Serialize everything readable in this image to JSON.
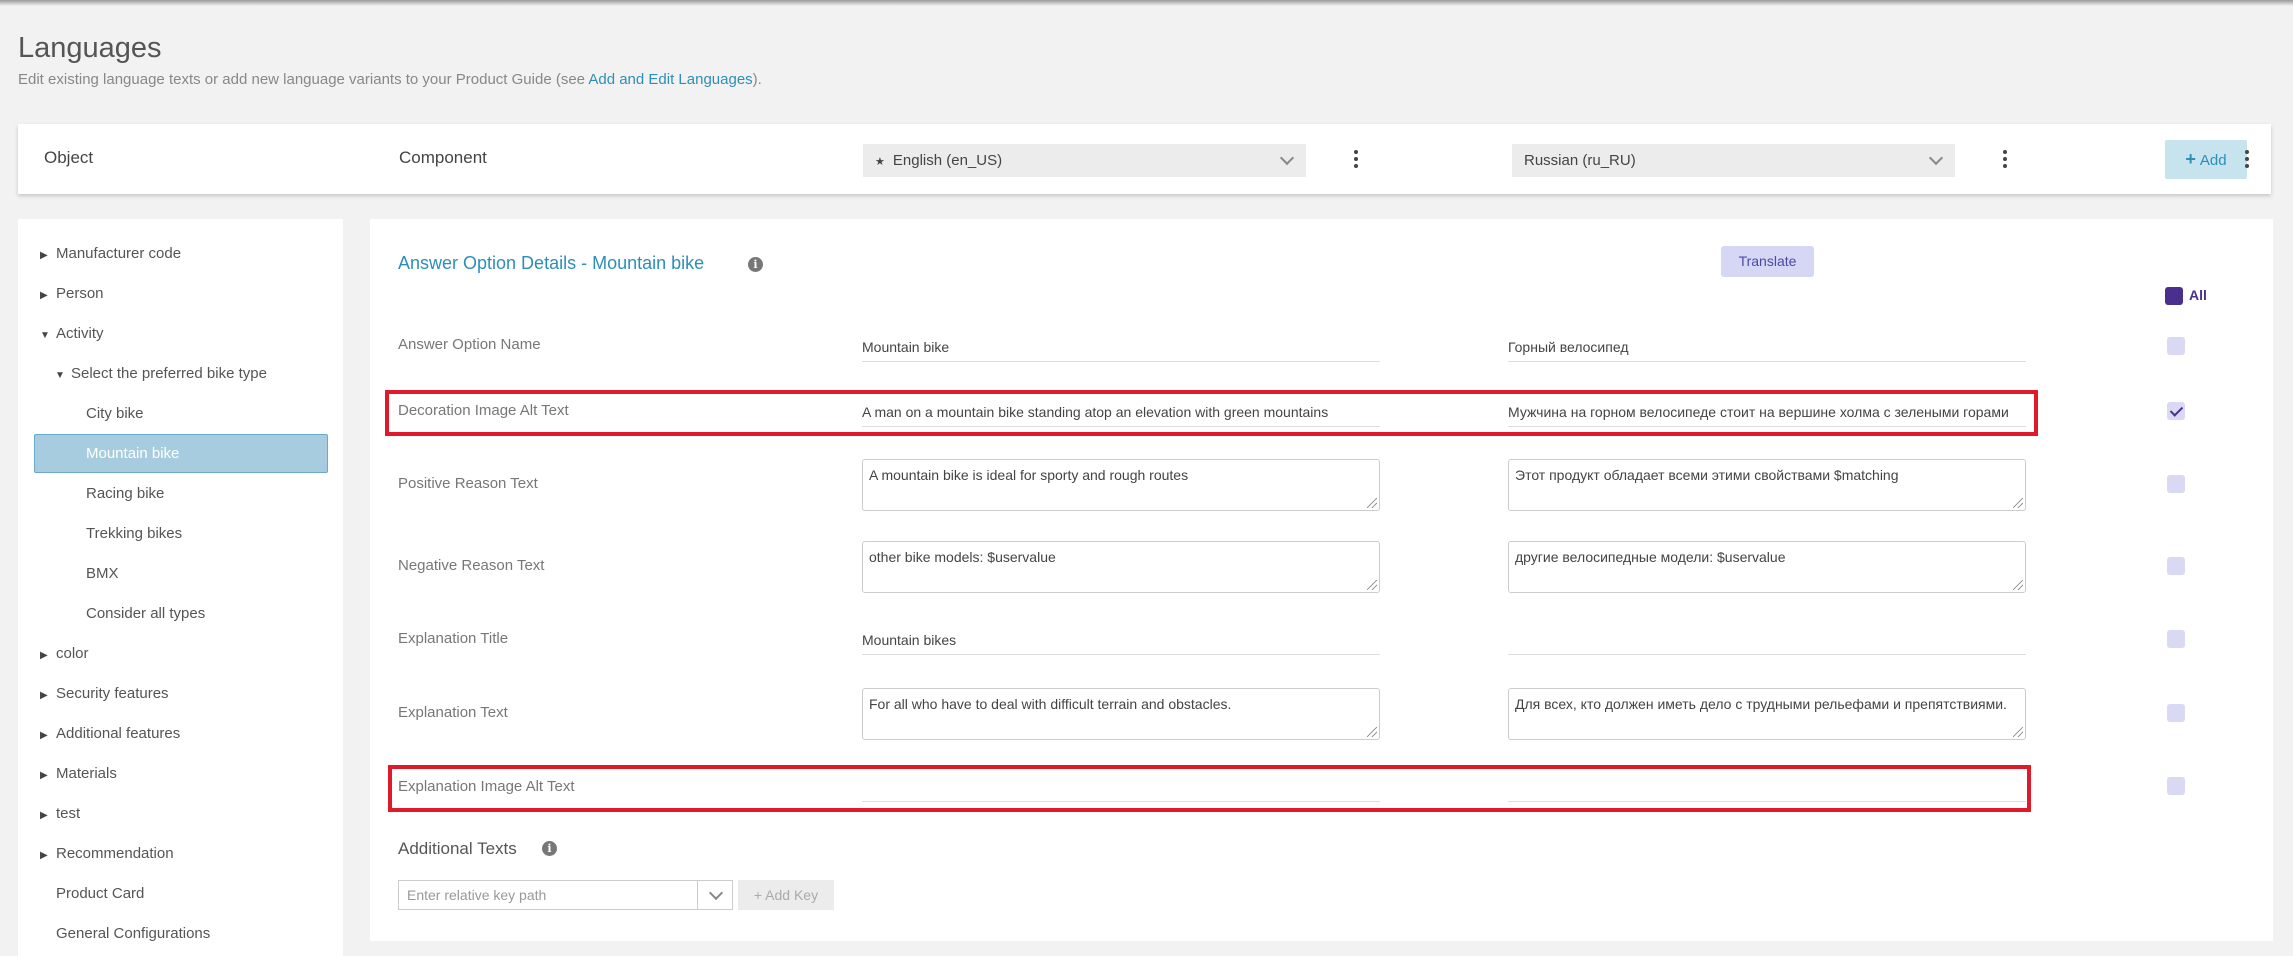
{
  "page": {
    "title": "Languages",
    "subtitle_prefix": "Edit existing language texts or add new language variants to your Product Guide (see ",
    "subtitle_link": "Add and Edit Languages",
    "subtitle_suffix": ")."
  },
  "header": {
    "object_label": "Object",
    "component_label": "Component",
    "primary_language": "English (en_US)",
    "secondary_language": "Russian (ru_RU)",
    "add_label": "Add"
  },
  "tree": [
    {
      "label": "Manufacturer code",
      "arrow": "▶"
    },
    {
      "label": "Person",
      "arrow": "▶"
    },
    {
      "label": "Activity",
      "arrow": "▼"
    },
    {
      "label": "Select the preferred bike type",
      "arrow": "▼"
    },
    {
      "label": "City bike",
      "arrow": ""
    },
    {
      "label": "Mountain bike",
      "arrow": "",
      "selected": true
    },
    {
      "label": "Racing bike",
      "arrow": ""
    },
    {
      "label": "Trekking bikes",
      "arrow": ""
    },
    {
      "label": "BMX",
      "arrow": ""
    },
    {
      "label": "Consider all types",
      "arrow": ""
    },
    {
      "label": "color",
      "arrow": "▶"
    },
    {
      "label": "Security features",
      "arrow": "▶"
    },
    {
      "label": "Additional features",
      "arrow": "▶"
    },
    {
      "label": "Materials",
      "arrow": "▶"
    },
    {
      "label": "test",
      "arrow": "▶"
    },
    {
      "label": "Recommendation",
      "arrow": "▶"
    },
    {
      "label": "Product Card",
      "arrow": ""
    },
    {
      "label": "General Configurations",
      "arrow": ""
    }
  ],
  "details": {
    "title": "Answer Option Details - Mountain bike",
    "translate_label": "Translate",
    "all_label": "All",
    "rows": [
      {
        "label": "Answer Option Name",
        "en": "Mountain bike",
        "ru": "Горный велосипед",
        "checked": false
      },
      {
        "label": "Decoration Image Alt Text",
        "en": "A man on a mountain bike standing atop an elevation with green mountains",
        "ru": "Мужчина на горном велосипеде стоит на вершине холма с зелеными горами",
        "checked": true
      },
      {
        "label": "Positive Reason Text",
        "en": "A mountain bike is ideal for sporty and rough routes",
        "ru": "Этот продукт обладает всеми этими свойствами $matching",
        "checked": false
      },
      {
        "label": "Negative Reason Text",
        "en": "other bike models: $uservalue",
        "ru": "другие велосипедные модели: $uservalue",
        "checked": false
      },
      {
        "label": "Explanation Title",
        "en": "Mountain bikes",
        "ru": "",
        "checked": false
      },
      {
        "label": "Explanation Text",
        "en": "For all who have to deal with difficult terrain and obstacles.",
        "ru": "Для всех, кто должен иметь дело с трудными рельефами и препятствиями.",
        "checked": false
      },
      {
        "label": "Explanation Image Alt Text",
        "en": "",
        "ru": "",
        "checked": false
      }
    ],
    "additional_texts_title": "Additional Texts",
    "key_placeholder": "Enter relative key path",
    "add_key_label": "Add Key"
  }
}
